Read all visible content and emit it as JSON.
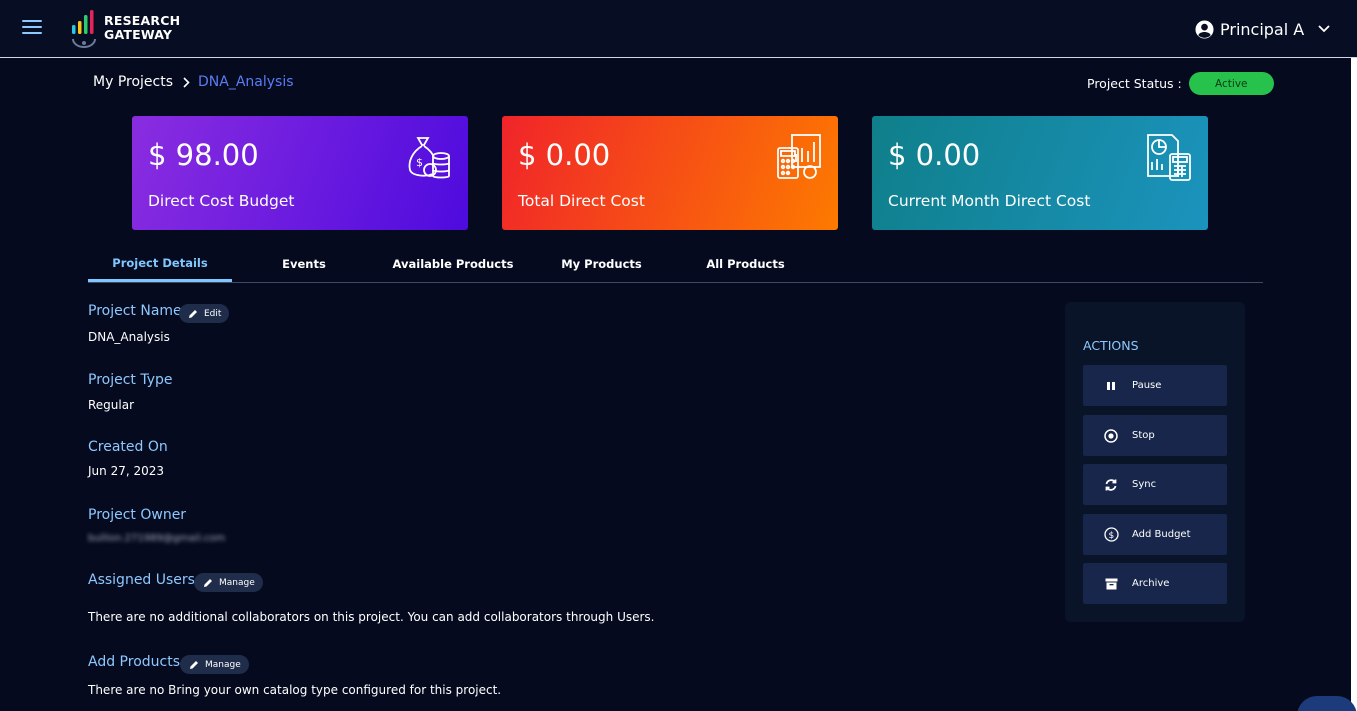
{
  "app": {
    "brand_line1": "RESEARCH",
    "brand_line2": "GATEWAY",
    "user_name": "Principal A"
  },
  "breadcrumb": {
    "root": "My Projects",
    "current": "DNA_Analysis"
  },
  "status": {
    "label": "Project Status :",
    "value": "Active",
    "color": "#27c24c"
  },
  "cards": [
    {
      "value": "$ 98.00",
      "label": "Direct Cost Budget",
      "icon": "money-bag-icon"
    },
    {
      "value": "$ 0.00",
      "label": "Total Direct Cost",
      "icon": "calculator-chart-icon"
    },
    {
      "value": "$ 0.00",
      "label": "Current Month Direct Cost",
      "icon": "report-calculator-icon"
    }
  ],
  "tabs": [
    {
      "label": "Project Details",
      "active": true
    },
    {
      "label": "Events",
      "active": false
    },
    {
      "label": "Available Products",
      "active": false
    },
    {
      "label": "My Products",
      "active": false
    },
    {
      "label": "All Products",
      "active": false
    }
  ],
  "details": {
    "project_name_label": "Project Name",
    "edit_label": "Edit",
    "project_name": "DNA_Analysis",
    "project_type_label": "Project Type",
    "project_type": "Regular",
    "created_on_label": "Created On",
    "created_on": "Jun 27, 2023",
    "owner_label": "Project Owner",
    "owner": "bullion.271989@gmail.com",
    "assigned_users_label": "Assigned Users",
    "manage_label": "Manage",
    "assigned_users_text": "There are no additional collaborators on this project. You can add collaborators through Users.",
    "add_products_label": "Add Products",
    "add_products_text": "There are no Bring your own catalog type configured for this project."
  },
  "actions": {
    "title": "ACTIONS",
    "items": [
      {
        "label": "Pause",
        "icon": "pause-icon"
      },
      {
        "label": "Stop",
        "icon": "stop-circle-icon"
      },
      {
        "label": "Sync",
        "icon": "sync-icon"
      },
      {
        "label": "Add Budget",
        "icon": "dollar-circle-icon"
      },
      {
        "label": "Archive",
        "icon": "archive-icon"
      }
    ]
  }
}
